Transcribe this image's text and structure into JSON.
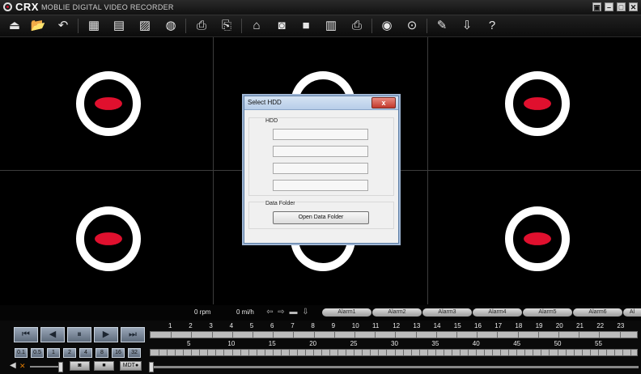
{
  "app": {
    "name": "CRX",
    "subtitle": "MOBLIE DIGITAL VIDEO RECORDER",
    "window_buttons": [
      "▣",
      "–",
      "□",
      "✕"
    ]
  },
  "toolbar": {
    "icons": [
      "capture-screen-icon",
      "open-folder-icon",
      "undo-icon",
      "grid-view-icon",
      "list-view-icon",
      "graph-view-icon",
      "globe-map-icon",
      "camera-settings-icon",
      "camera-edit-icon",
      "backup-icon",
      "snapshot-icon",
      "video-camera-icon",
      "clipboard-icon",
      "print-icon",
      "disc-icon",
      "timer-icon",
      "wrench-settings-icon",
      "download-icon",
      "help-icon"
    ],
    "glyphs": [
      "⏏",
      "📂",
      "↶",
      "▦",
      "▤",
      "▨",
      "◍",
      "⎙",
      "⎘",
      "⌂",
      "◙",
      "■",
      "▥",
      "⎙",
      "◉",
      "⊙",
      "✎",
      "⇩",
      "?"
    ]
  },
  "colors": {
    "accent_red": "#e0102e"
  },
  "dialog": {
    "title": "Select HDD",
    "close_label": "x",
    "hdd_label": "HDD",
    "data_folder_label": "Data Folder",
    "open_button": "Open Data Folder"
  },
  "status": {
    "rpm": "0 rpm",
    "speed": "0 mi/h",
    "alarms": [
      "Alarm1",
      "Alarm2",
      "Alarm3",
      "Alarm4",
      "Alarm5",
      "Alarm6",
      "Al"
    ]
  },
  "playback": {
    "transport": [
      "⏮",
      "◀",
      "⏸",
      "▶",
      "⏭"
    ],
    "speeds": [
      "0.1",
      "0.5",
      "1",
      "2",
      "4",
      "8",
      "16",
      "32"
    ],
    "snapshot_label": "◙",
    "record_label": "■",
    "mdt_label": "MDT●"
  },
  "timeline": {
    "hours": [
      "1",
      "2",
      "3",
      "4",
      "5",
      "6",
      "7",
      "8",
      "9",
      "10",
      "11",
      "12",
      "13",
      "14",
      "15",
      "16",
      "17",
      "18",
      "19",
      "20",
      "21",
      "22",
      "23"
    ],
    "minutes": [
      "5",
      "10",
      "15",
      "20",
      "25",
      "30",
      "35",
      "40",
      "45",
      "50",
      "55"
    ]
  }
}
